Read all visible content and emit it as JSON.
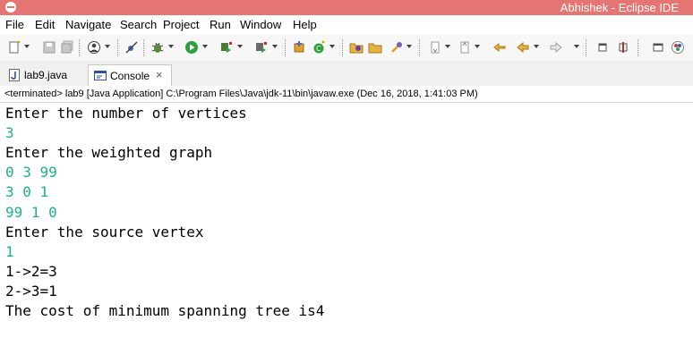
{
  "window": {
    "title": "Abhishek - Eclipse IDE"
  },
  "menu": [
    "File",
    "Edit",
    "Navigate",
    "Search",
    "Project",
    "Run",
    "Window",
    "Help"
  ],
  "tabs": [
    {
      "label": "lab9.java",
      "icon": "java-file-icon"
    },
    {
      "label": "Console",
      "icon": "console-icon",
      "close": "×"
    }
  ],
  "status": "<terminated> lab9 [Java Application] C:\\Program Files\\Java\\jdk-11\\bin\\javaw.exe (Dec 16, 2018, 1:41:03 PM)",
  "colors": {
    "title_bar": "#e47572",
    "prompt_text": "#000000",
    "user_input": "#1fb089"
  },
  "console": {
    "lines": [
      {
        "text": "Enter the number of vertices",
        "kind": "output"
      },
      {
        "text": "3",
        "kind": "input"
      },
      {
        "text": "Enter the weighted graph",
        "kind": "output"
      },
      {
        "text": "0 3 99",
        "kind": "input"
      },
      {
        "text": "3 0 1",
        "kind": "input"
      },
      {
        "text": "99 1 0",
        "kind": "input"
      },
      {
        "text": "Enter the source vertex",
        "kind": "output"
      },
      {
        "text": "1",
        "kind": "input"
      },
      {
        "text": "1->2=3",
        "kind": "output"
      },
      {
        "text": "2->3=1",
        "kind": "output"
      },
      {
        "text": "The cost of minimum spanning tree is4",
        "kind": "output"
      }
    ]
  }
}
